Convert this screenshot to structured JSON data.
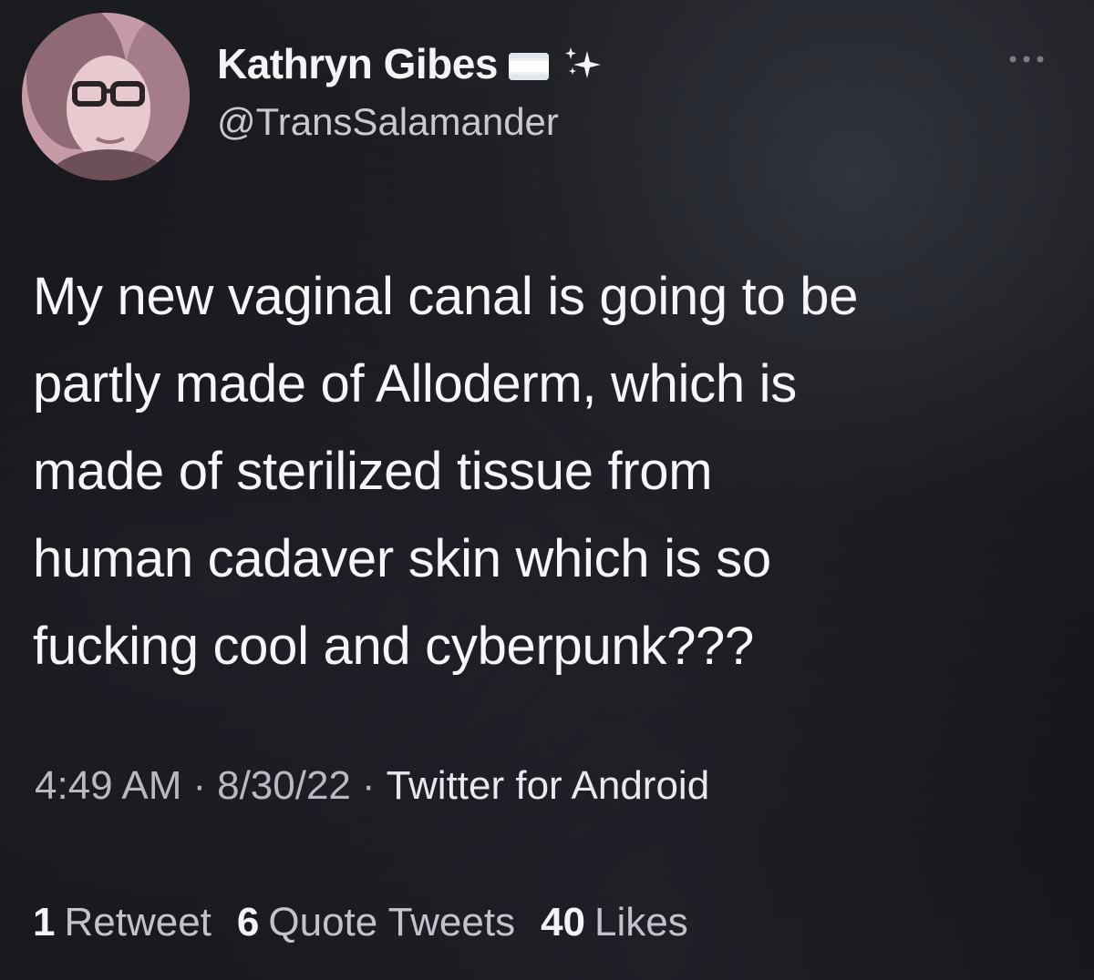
{
  "author": {
    "display_name": "Kathryn Gibes",
    "handle": "@TransSalamander",
    "name_icons": [
      "flag-icon",
      "sparkles-icon"
    ]
  },
  "tweet": {
    "text_lines": [
      "My new vaginal canal is going to be",
      "partly made of Alloderm, which is",
      "made of sterilized tissue from",
      "human cadaver skin which is so",
      "fucking cool and cyberpunk???"
    ],
    "time": "4:49 AM",
    "date": "8/30/22",
    "separator": "·",
    "source": "Twitter for Android"
  },
  "stats": {
    "retweets": {
      "count": "1",
      "label": "Retweet"
    },
    "quote_tweets": {
      "count": "6",
      "label": "Quote Tweets"
    },
    "likes": {
      "count": "40",
      "label": "Likes"
    }
  },
  "colors": {
    "background": "#131418",
    "primary_text": "#f6f6f8",
    "secondary_text": "#b9bac1"
  }
}
